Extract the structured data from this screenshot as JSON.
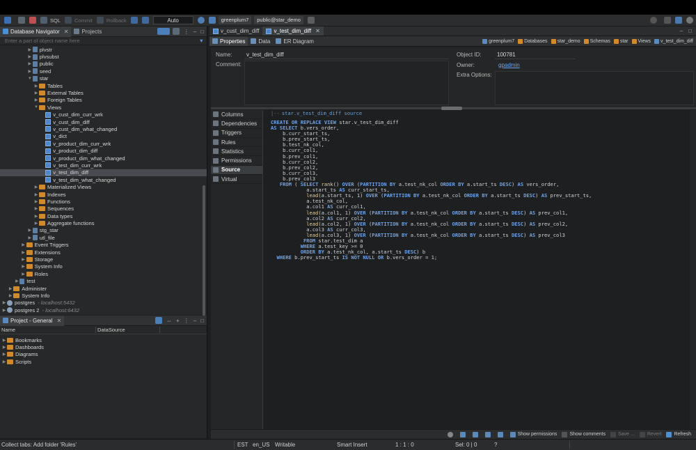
{
  "toolbar": {
    "sql": "SQL",
    "commit": "Commit",
    "rollback": "Rollback",
    "tx_mode": "Auto",
    "connection": "greenplum7",
    "schema": "public@star_demo"
  },
  "navigator": {
    "tab_label": "Database Navigator",
    "projects_tab_label": "Projects",
    "filter_placeholder": "Enter a part of object name here",
    "items": [
      {
        "label": "plvstr",
        "indent": 4,
        "type": "db"
      },
      {
        "label": "plvsubst",
        "indent": 4,
        "type": "db"
      },
      {
        "label": "public",
        "indent": 4,
        "type": "db"
      },
      {
        "label": "seed",
        "indent": 4,
        "type": "db"
      },
      {
        "label": "star",
        "indent": 4,
        "type": "db",
        "open": true
      },
      {
        "label": "Tables",
        "indent": 5,
        "type": "folder"
      },
      {
        "label": "External Tables",
        "indent": 5,
        "type": "folder"
      },
      {
        "label": "Foreign Tables",
        "indent": 5,
        "type": "folder"
      },
      {
        "label": "Views",
        "indent": 5,
        "type": "folder",
        "open": true
      },
      {
        "label": "v_cust_dim_curr_wrk",
        "indent": 6,
        "type": "view"
      },
      {
        "label": "v_cust_dim_diff",
        "indent": 6,
        "type": "view"
      },
      {
        "label": "v_cust_dim_what_changed",
        "indent": 6,
        "type": "view"
      },
      {
        "label": "v_dict",
        "indent": 6,
        "type": "view"
      },
      {
        "label": "v_product_dim_curr_wrk",
        "indent": 6,
        "type": "view"
      },
      {
        "label": "v_product_dim_diff",
        "indent": 6,
        "type": "view"
      },
      {
        "label": "v_product_dim_what_changed",
        "indent": 6,
        "type": "view"
      },
      {
        "label": "v_test_dim_curr_wrk",
        "indent": 6,
        "type": "view"
      },
      {
        "label": "v_test_dim_diff",
        "indent": 6,
        "type": "view",
        "selected": true
      },
      {
        "label": "v_test_dim_what_changed",
        "indent": 6,
        "type": "view"
      },
      {
        "label": "Materialized Views",
        "indent": 5,
        "type": "folder"
      },
      {
        "label": "Indexes",
        "indent": 5,
        "type": "folder"
      },
      {
        "label": "Functions",
        "indent": 5,
        "type": "folder"
      },
      {
        "label": "Sequences",
        "indent": 5,
        "type": "folder"
      },
      {
        "label": "Data types",
        "indent": 5,
        "type": "folder"
      },
      {
        "label": "Aggregate functions",
        "indent": 5,
        "type": "folder"
      },
      {
        "label": "stg_star",
        "indent": 4,
        "type": "db"
      },
      {
        "label": "utl_file",
        "indent": 4,
        "type": "db"
      },
      {
        "label": "Event Triggers",
        "indent": 3,
        "type": "folder"
      },
      {
        "label": "Extensions",
        "indent": 3,
        "type": "folder"
      },
      {
        "label": "Storage",
        "indent": 3,
        "type": "folder"
      },
      {
        "label": "System Info",
        "indent": 3,
        "type": "folder"
      },
      {
        "label": "Roles",
        "indent": 3,
        "type": "folder"
      },
      {
        "label": "test",
        "indent": 2,
        "type": "db"
      },
      {
        "label": "Administer",
        "indent": 1,
        "type": "folder"
      },
      {
        "label": "System Info",
        "indent": 1,
        "type": "folder"
      },
      {
        "label": "postgres",
        "indent": 0,
        "type": "conn",
        "extra": "- localhost:5432"
      },
      {
        "label": "postgres 2",
        "indent": 0,
        "type": "conn",
        "extra": "- localhost:6432"
      }
    ]
  },
  "project": {
    "tab_label": "Project - General",
    "col_name": "Name",
    "col_datasource": "DataSource",
    "items": [
      "Bookmarks",
      "Dashboards",
      "Diagrams",
      "Scripts"
    ]
  },
  "editor": {
    "tabs": [
      "v_cust_dim_diff",
      "v_test_dim_diff"
    ],
    "subtabs": [
      "Properties",
      "Data",
      "ER Diagram"
    ],
    "breadcrumbs": [
      "greenplum7",
      "Databases",
      "star_demo",
      "Schemas",
      "star",
      "Views",
      "v_test_dim_diff"
    ],
    "props": {
      "name_label": "Name:",
      "name_value": "v_test_dim_diff",
      "comment_label": "Comment:",
      "objid_label": "Object ID:",
      "objid_value": "100781",
      "owner_label": "Owner:",
      "owner_value": "gpadmin",
      "extra_label": "Extra Options:"
    },
    "side_tabs": [
      "Columns",
      "Dependencies",
      "Triggers",
      "Rules",
      "Statistics",
      "Permissions",
      "Source",
      "Virtual"
    ],
    "source_header": "star.v_test_dim_diff source",
    "bottom": {
      "show_permissions": "Show permissions",
      "show_comments": "Show comments",
      "save": "Save ...",
      "revert": "Revert",
      "refresh": "Refresh"
    }
  },
  "status": {
    "message": "Collect tabs: Add folder 'Rules'",
    "tz": "EST",
    "locale": "en_US",
    "mode": "Writable",
    "insert": "Smart Insert",
    "pos": "1 : 1 : 0",
    "sel": "Sel: 0 | 0",
    "help": "?"
  }
}
